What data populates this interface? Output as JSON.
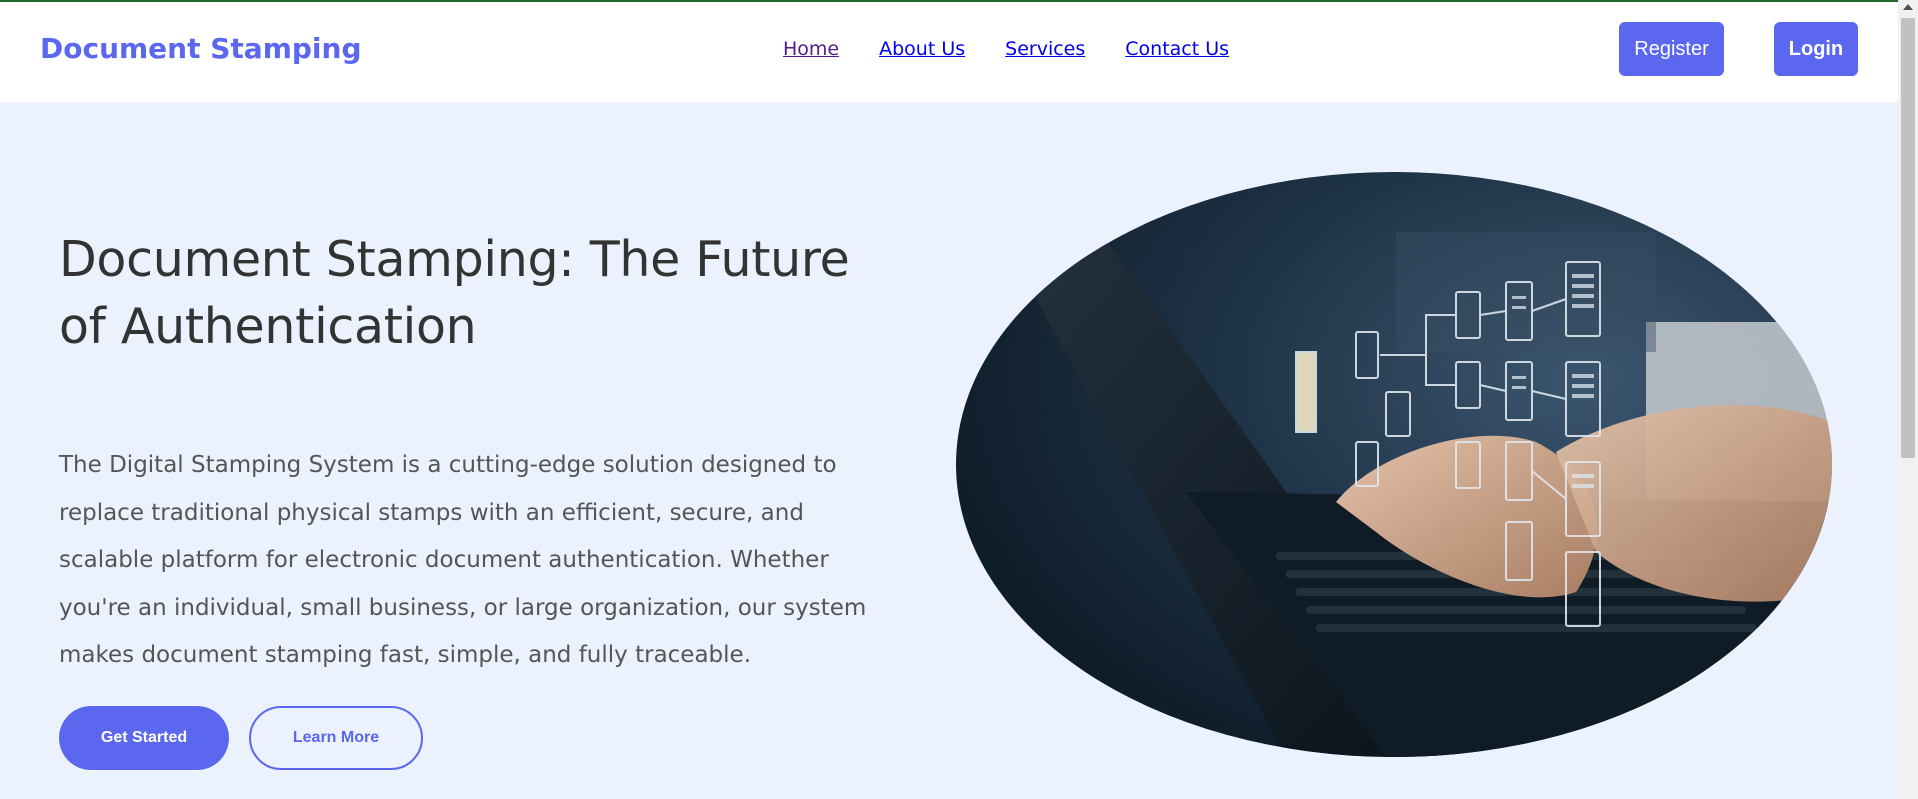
{
  "header": {
    "brand": "Document Stamping",
    "nav": [
      "Home",
      "About Us",
      "Services",
      "Contact Us"
    ],
    "register_label": "Register",
    "login_label": "Login"
  },
  "hero": {
    "title": "Document Stamping: The Future of Authentication",
    "description": "The Digital Stamping System is a cutting-edge solution designed to replace traditional physical stamps with an efficient, secure, and scalable platform for electronic document authentication. Whether you're an individual, small business, or large organization, our system makes document stamping fast, simple, and fully traceable.",
    "get_started_label": "Get Started",
    "learn_more_label": "Learn More"
  },
  "colors": {
    "accent": "#5b67ee",
    "hero_bg": "#ebf2fe",
    "title_text": "#333333",
    "body_text": "#555555"
  }
}
